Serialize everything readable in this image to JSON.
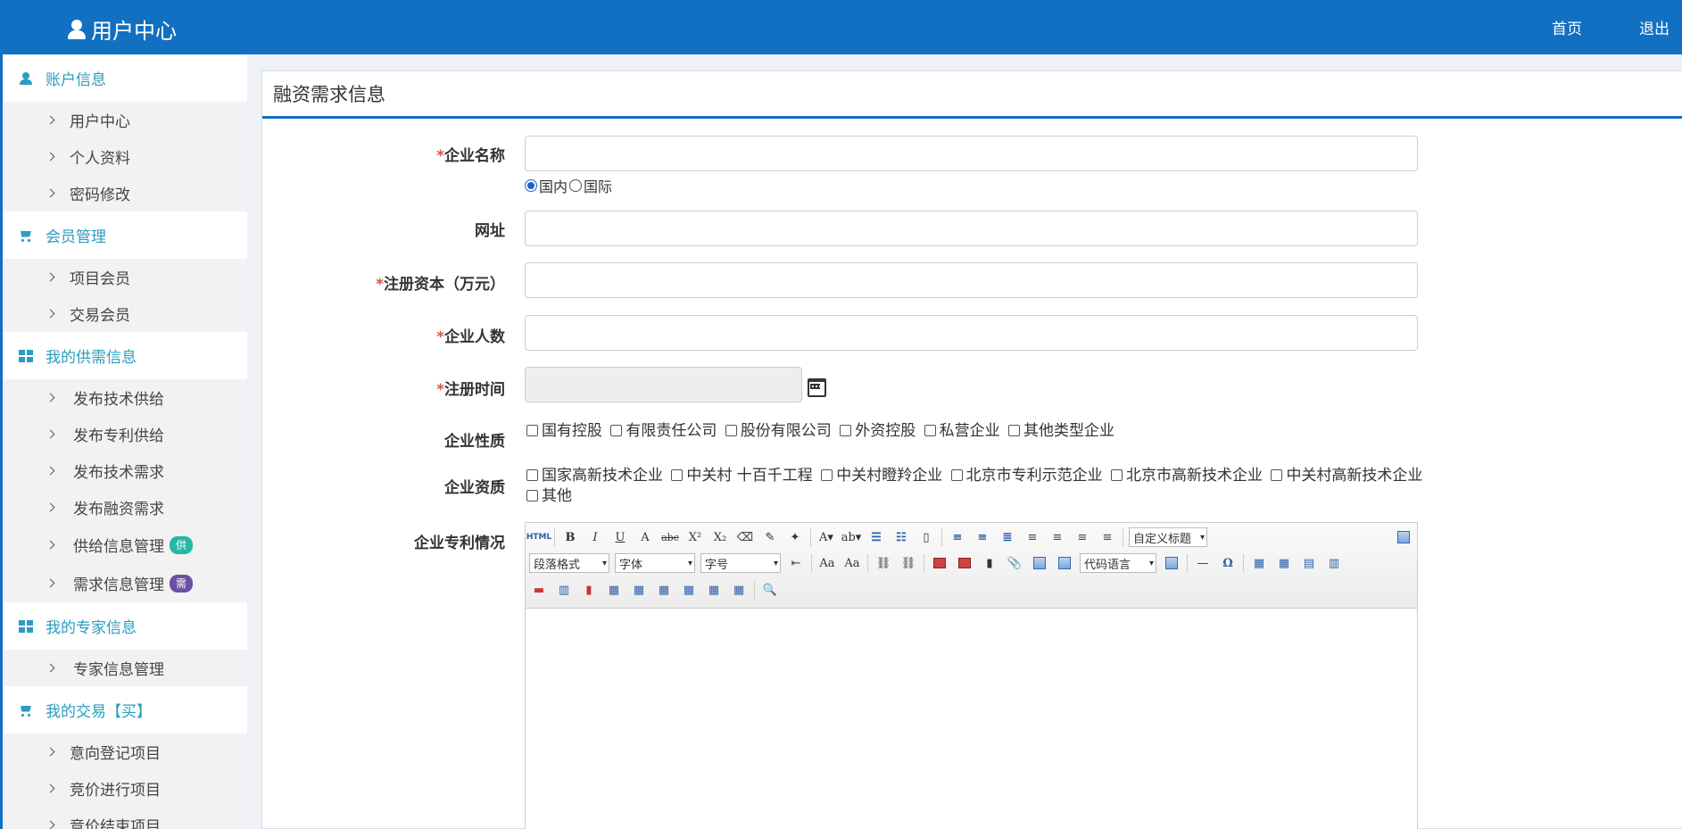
{
  "header": {
    "title": "用户中心",
    "home": "首页",
    "logout": "退出"
  },
  "sidebar": {
    "sections": [
      {
        "title": "账户信息",
        "icon": "user-icon",
        "items": [
          "用户中心",
          "个人资料",
          "密码修改"
        ]
      },
      {
        "title": "会员管理",
        "icon": "cart-icon",
        "items": [
          "项目会员",
          "交易会员"
        ]
      },
      {
        "title": "我的供需信息",
        "icon": "windows-icon",
        "items": [
          "发布技术供给",
          "发布专利供给",
          "发布技术需求",
          "发布融资需求",
          "供给信息管理",
          "需求信息管理"
        ],
        "badges": {
          "supply": "供",
          "demand": "需"
        }
      },
      {
        "title": "我的专家信息",
        "icon": "windows-icon",
        "items": [
          "专家信息管理"
        ]
      },
      {
        "title": "我的交易【买】",
        "icon": "cart-icon",
        "items": [
          "意向登记项目",
          "竞价进行项目",
          "竞价结束项目"
        ]
      }
    ]
  },
  "form": {
    "title": "融资需求信息",
    "required_mark": "*",
    "labels": {
      "company_name": "企业名称",
      "website": "网址",
      "capital": "注册资本（万元）",
      "staff": "企业人数",
      "reg_date": "注册时间",
      "nature": "企业性质",
      "qualification": "企业资质",
      "patents": "企业专利情况"
    },
    "region": {
      "domestic": "国内",
      "international": "国际",
      "selected": "国内"
    },
    "nature_options": [
      "国有控股",
      "有限责任公司",
      "股份有限公司",
      "外资控股",
      "私营企业",
      "其他类型企业"
    ],
    "qualification_options": [
      "国家高新技术企业",
      "中关村 十百千工程",
      "中关村瞪羚企业",
      "北京市专利示范企业",
      "北京市高新技术企业",
      "中关村高新技术企业",
      "其他"
    ],
    "editor": {
      "custom_title": "自定义标题",
      "paragraph": "段落格式",
      "font": "字体",
      "size": "字号",
      "code_lang": "代码语言",
      "html": "HTML"
    }
  }
}
